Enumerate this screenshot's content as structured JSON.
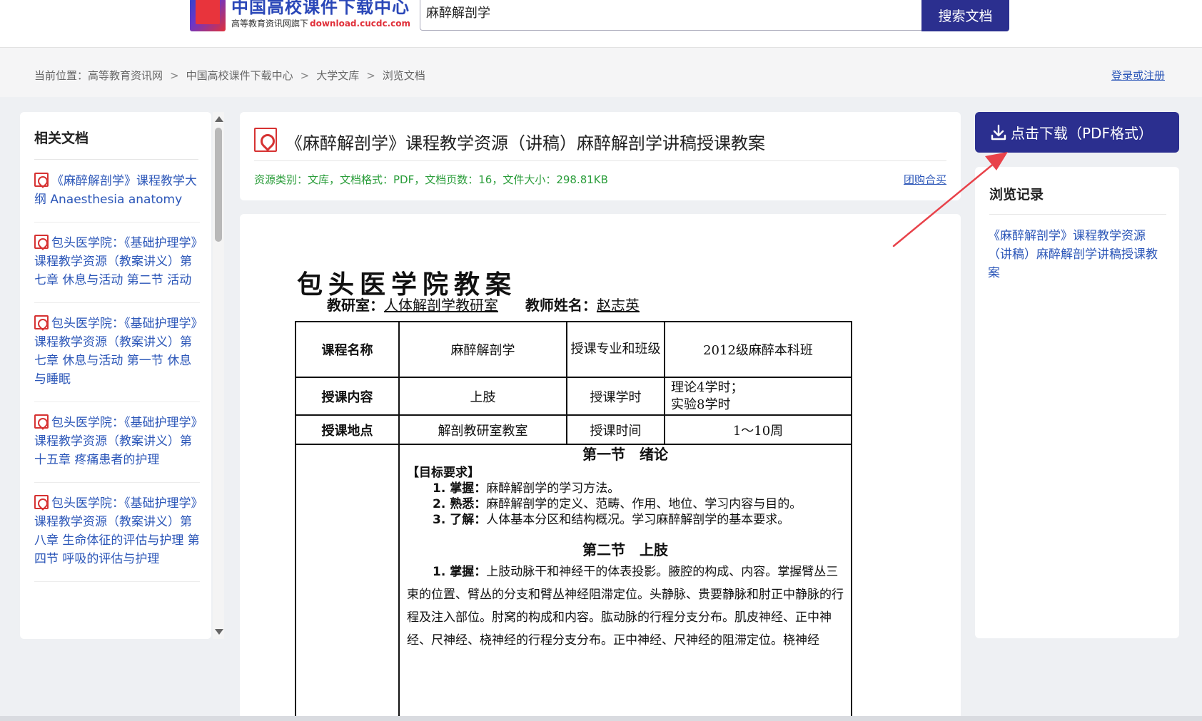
{
  "header": {
    "logo_title": "中国高校课件下载中心",
    "logo_sub": "高等教育资讯网旗下",
    "logo_domain": "download.cucdc.com",
    "search_value": "麻醉解剖学",
    "search_button": "搜索文档"
  },
  "breadcrumb": {
    "prefix": "当前位置：",
    "items": [
      "高等教育资讯网",
      "中国高校课件下载中心",
      "大学文库",
      "浏览文档"
    ],
    "separator": ">",
    "login": "登录或注册"
  },
  "related": {
    "title": "相关文档",
    "items": [
      "《麻醉解剖学》课程教学大纲 Anaesthesia anatomy",
      "包头医学院：《基础护理学》课程教学资源（教案讲义）第七章 休息与活动 第二节 活动",
      "包头医学院：《基础护理学》课程教学资源（教案讲义）第七章 休息与活动 第一节 休息与睡眠",
      "包头医学院：《基础护理学》课程教学资源（教案讲义）第十五章 疼痛患者的护理",
      "包头医学院：《基础护理学》课程教学资源（教案讲义）第八章 生命体征的评估与护理 第四节 呼吸的评估与护理"
    ]
  },
  "document": {
    "title": "《麻醉解剖学》课程教学资源（讲稿）麻醉解剖学讲稿授课教案",
    "meta": "资源类别：文库，文档格式：PDF，文档页数：16，文件大小：298.81KB",
    "group_buy": "团购合买"
  },
  "page": {
    "school": "包头医学院教案",
    "dept_label": "教研室：",
    "dept_value": "人体解剖学教研室",
    "teacher_label": "教师姓名：",
    "teacher_value": "赵志英",
    "course_label": "课程名称",
    "course_value": "麻醉解剖学",
    "major_label": "授课专业和班级",
    "major_value": "2012级麻醉本科班",
    "content_label": "授课内容",
    "content_value": "上肢",
    "hours_label": "授课学时",
    "hours_value_1": "理论4学时；",
    "hours_value_2": "实验8学时",
    "place_label": "授课地点",
    "place_value": "解剖教研室教室",
    "time_label": "授课时间",
    "time_value": "1～10周",
    "sec1_title": "第一节　绪论",
    "goal_title": "【目标要求】",
    "goal1_label": "1. 掌握：",
    "goal1_text": "麻醉解剖学的学习方法。",
    "goal2_label": "2. 熟悉：",
    "goal2_text": "麻醉解剖学的定义、范畴、作用、地位、学习内容与目的。",
    "goal3_label": "3. 了解：",
    "goal3_text": "人体基本分区和结构概况。学习麻醉解剖学的基本要求。",
    "sec2_title": "第二节　上肢",
    "sec2_label": "1. 掌握：",
    "sec2_text": "上肢动脉干和神经干的体表投影。腋腔的构成、内容。掌握臂丛三束的位置、臂丛的分支和臂丛神经阻滞定位。头静脉、贵要静脉和肘正中静脉的行程及注入部位。肘窝的构成和内容。肱动脉的行程分支分布。肌皮神经、正中神经、尺神经、桡神经的行程分支分布。正中神经、尺神经的阻滞定位。桡神经"
  },
  "sidebar_right": {
    "download": "点击下载（PDF格式）",
    "history_title": "浏览记录",
    "history_items": [
      "《麻醉解剖学》课程教学资源（讲稿）麻醉解剖学讲稿授课教案"
    ]
  },
  "colors": {
    "brand": "#2b2f8f",
    "link": "#2b56b8",
    "meta_green": "#2a9d3a",
    "pdf_red": "#d63232",
    "arrow_red": "#e8424a"
  }
}
